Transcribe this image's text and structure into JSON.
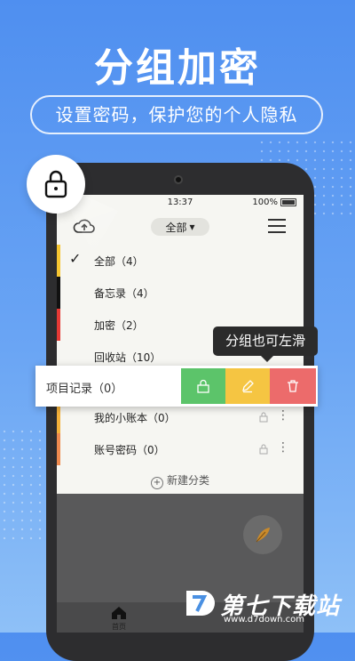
{
  "promo": {
    "headline": "分组加密",
    "subtitle": "设置密码，保护您的个人隐私"
  },
  "status_bar": {
    "time": "13:37",
    "battery": "100%"
  },
  "topbar": {
    "filter_label": "全部"
  },
  "categories": [
    {
      "label": "全部（4）",
      "color": "#f5c531",
      "checked": true
    },
    {
      "label": "备忘录（4）",
      "color": "#111111"
    },
    {
      "label": "加密（2）",
      "color": "#e53935"
    },
    {
      "label": "回收站（10）",
      "color": "#f6f6f2"
    },
    {
      "label": "我的小账本（0）",
      "color": "#f4b13a"
    },
    {
      "label": "账号密码（0）",
      "color": "#ee8a4f"
    }
  ],
  "swipe_row": {
    "label": "项目记录（0）",
    "actions": [
      {
        "name": "lock",
        "color": "#5cc46a"
      },
      {
        "name": "edit",
        "color": "#f5c542"
      },
      {
        "name": "delete",
        "color": "#ec6b6b"
      }
    ]
  },
  "tooltip": "分组也可左滑",
  "new_category": "新建分类",
  "tabbar": {
    "home_label": "首页"
  },
  "watermark": {
    "title": "第七下载站",
    "url": "www.d7down.com"
  }
}
